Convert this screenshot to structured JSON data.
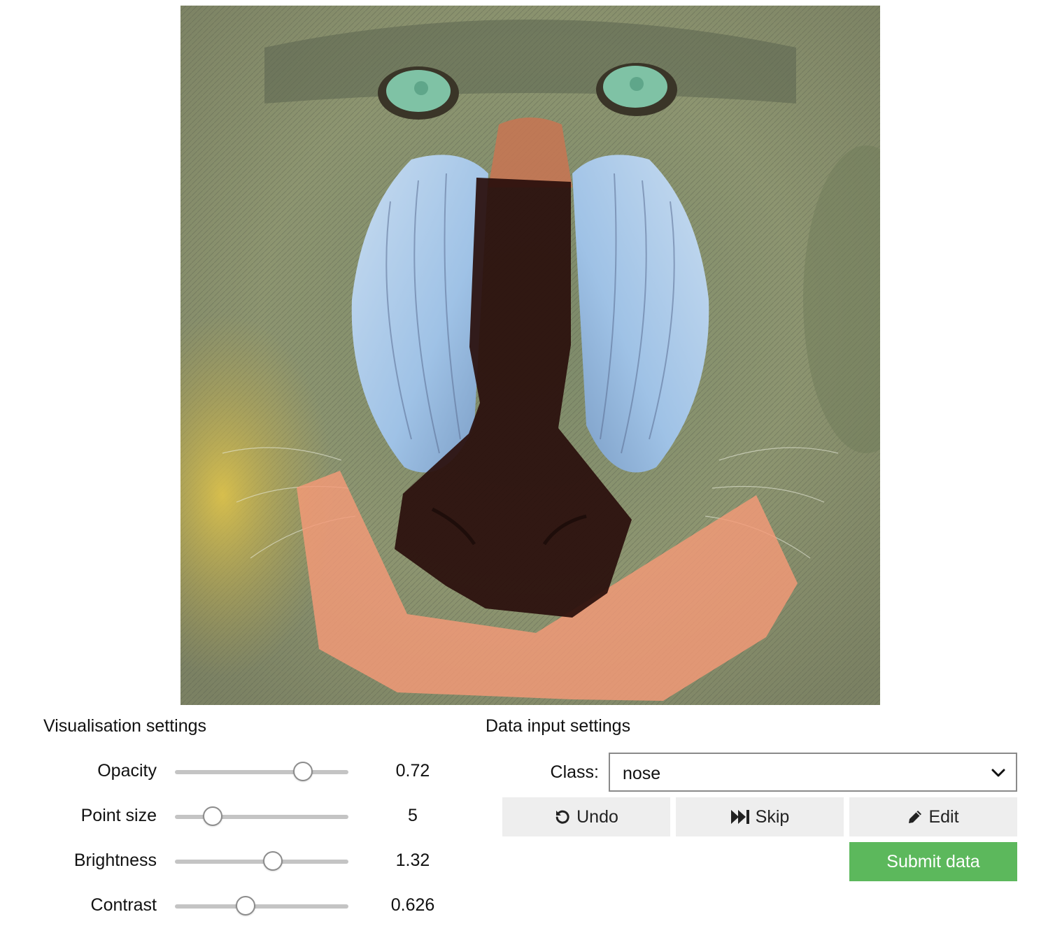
{
  "visualisation": {
    "title": "Visualisation settings",
    "sliders": [
      {
        "label": "Opacity",
        "value": "0.72",
        "fraction": 0.74
      },
      {
        "label": "Point size",
        "value": "5",
        "fraction": 0.22
      },
      {
        "label": "Brightness",
        "value": "1.32",
        "fraction": 0.57
      },
      {
        "label": "Contrast",
        "value": "0.626",
        "fraction": 0.41
      }
    ]
  },
  "data_input": {
    "title": "Data input settings",
    "class_label": "Class:",
    "class_value": "nose",
    "undo_label": "Undo",
    "skip_label": "Skip",
    "edit_label": "Edit",
    "submit_label": "Submit data"
  },
  "annotations": [
    {
      "class": "nose",
      "color": "#2a0f0c"
    },
    {
      "class": "mouth",
      "color": "#f59a78"
    }
  ],
  "colors": {
    "submit_button": "#5cb85c",
    "button_bg": "#eeeeee",
    "slider_track": "#c4c4c4"
  },
  "icons": {
    "undo": "undo-icon",
    "skip": "skip-forward-icon",
    "edit": "pencil-icon",
    "dropdown": "chevron-down-icon"
  }
}
